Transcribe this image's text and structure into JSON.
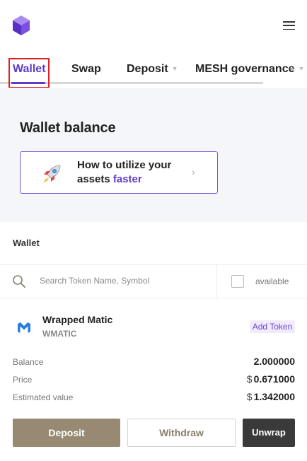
{
  "header": {
    "logo_icon": "mesh-hexagon-logo",
    "menu_icon": "hamburger-menu-icon"
  },
  "nav": {
    "tabs": [
      {
        "label": "Wallet",
        "active": true
      },
      {
        "label": "Swap"
      },
      {
        "label": "Deposit",
        "has_dropdown": true
      },
      {
        "label": "MESH governance",
        "has_dropdown": true
      }
    ],
    "accent_color": "#5f3bc9",
    "highlight_color": "#e01f24"
  },
  "balance": {
    "title": "Wallet balance",
    "promo": {
      "line1": "How to utilize your",
      "line2_plain": "assets ",
      "line2_accent": "faster",
      "icon": "rocket-icon"
    }
  },
  "wallet": {
    "label": "Wallet",
    "search": {
      "placeholder": "Search Token Name, Symbol",
      "value": ""
    },
    "available_label": "available",
    "available_checked": false
  },
  "token": {
    "name": "Wrapped Matic",
    "symbol": "WMATIC",
    "icon": "polygon-matic-icon",
    "add_token_label": "Add Token",
    "rows": [
      {
        "label": "Balance",
        "currency": "",
        "value": "2.000000"
      },
      {
        "label": "Price",
        "currency": "$",
        "value": "0.671000"
      },
      {
        "label": "Estimated value",
        "currency": "$",
        "value": "1.342000"
      }
    ]
  },
  "actions": {
    "deposit": "Deposit",
    "withdraw": "Withdraw",
    "unwrap": "Unwrap",
    "deposit_color": "#978972",
    "unwrap_color": "#3a3a3a"
  }
}
